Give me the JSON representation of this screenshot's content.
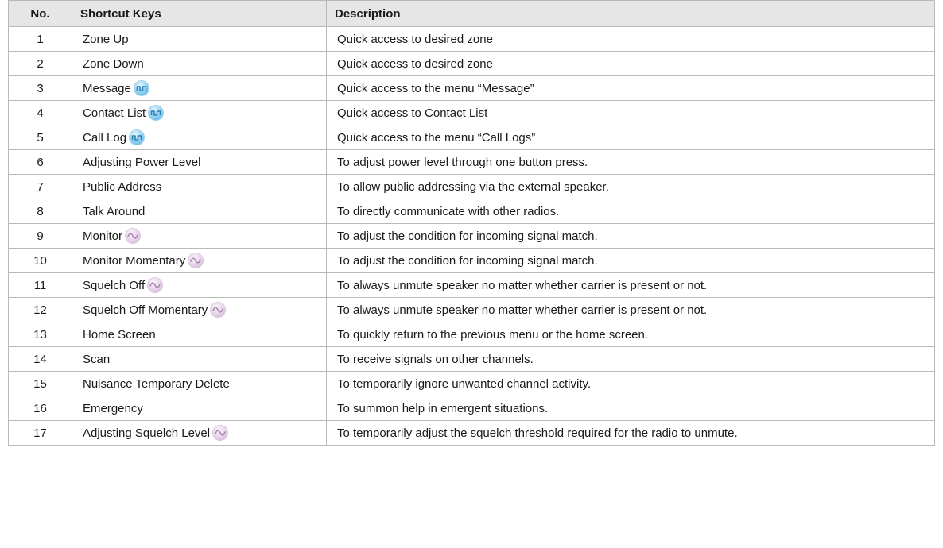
{
  "table": {
    "headers": {
      "no": "No.",
      "keys": "Shortcut Keys",
      "desc": "Description"
    },
    "rows": [
      {
        "no": "1",
        "key": "Zone Up",
        "icon": null,
        "desc": "Quick access to desired zone"
      },
      {
        "no": "2",
        "key": "Zone Down",
        "icon": null,
        "desc": "Quick access to desired zone"
      },
      {
        "no": "3",
        "key": "Message",
        "icon": "digital-icon",
        "desc": "Quick access to the menu “Message”"
      },
      {
        "no": "4",
        "key": "Contact List",
        "icon": "digital-icon",
        "desc": "Quick access to Contact List"
      },
      {
        "no": "5",
        "key": "Call Log",
        "icon": "digital-icon",
        "desc": "Quick access to the menu “Call Logs”"
      },
      {
        "no": "6",
        "key": "Adjusting Power Level",
        "icon": null,
        "desc": "To adjust power level through one button press."
      },
      {
        "no": "7",
        "key": "Public Address",
        "icon": null,
        "desc": "To allow public addressing via the external speaker."
      },
      {
        "no": "8",
        "key": "Talk Around",
        "icon": null,
        "desc": "To directly communicate with other radios."
      },
      {
        "no": "9",
        "key": "Monitor",
        "icon": "analog-icon",
        "desc": "To adjust the condition for incoming signal match."
      },
      {
        "no": "10",
        "key": "Monitor Momentary",
        "icon": "analog-icon",
        "desc": "To adjust the condition for incoming signal match."
      },
      {
        "no": "11",
        "key": "Squelch Off",
        "icon": "analog-icon",
        "desc": "To always unmute speaker no matter whether carrier is present or not."
      },
      {
        "no": "12",
        "key": "Squelch Off Momentary",
        "icon": "analog-icon",
        "desc": "To always unmute speaker no matter whether carrier is present or not."
      },
      {
        "no": "13",
        "key": "Home Screen",
        "icon": null,
        "desc": "To quickly return to the previous menu or the home screen."
      },
      {
        "no": "14",
        "key": "Scan",
        "icon": null,
        "desc": "To receive signals on other channels."
      },
      {
        "no": "15",
        "key": "Nuisance Temporary Delete",
        "icon": null,
        "desc": "To temporarily ignore unwanted channel activity."
      },
      {
        "no": "16",
        "key": "Emergency",
        "icon": null,
        "desc": "To summon help in emergent situations."
      },
      {
        "no": "17",
        "key": "Adjusting Squelch Level",
        "icon": "analog-icon",
        "desc": "To temporarily adjust the squelch threshold required for the radio to unmute."
      }
    ]
  },
  "colors": {
    "header_bg": "#e6e6e6",
    "border": "#b9b9b9",
    "digital_icon": "#5fb4e2",
    "analog_icon": "#d8c0dc"
  }
}
